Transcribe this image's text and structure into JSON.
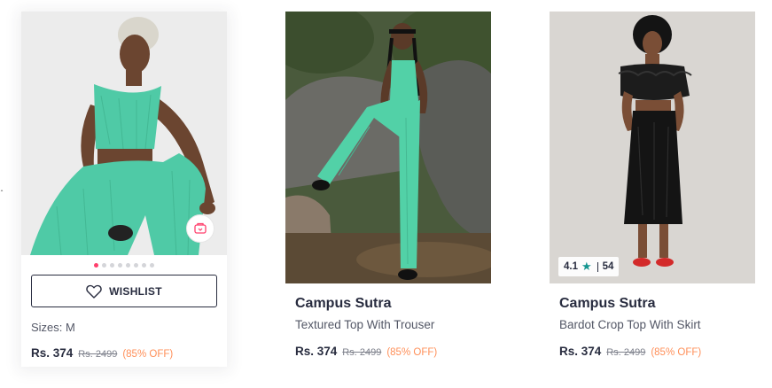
{
  "products": [
    {
      "brand": "",
      "name": "",
      "sizes": "Sizes: M",
      "price": "Rs. 374",
      "mrp": "Rs. 2499",
      "discount": "(85% OFF)",
      "wishlist_label": "WISHLIST",
      "carousel_active_index": 0,
      "carousel_count": 8,
      "colors": {
        "bg": "#ececec",
        "outfit": "#4fcaa6"
      }
    },
    {
      "brand": "Campus Sutra",
      "name": "Textured Top With Trouser",
      "price": "Rs. 374",
      "mrp": "Rs. 2499",
      "discount": "(85% OFF)",
      "colors": {
        "bg": "#4a5a3c",
        "outfit": "#52d1a7"
      }
    },
    {
      "brand": "Campus Sutra",
      "name": "Bardot Crop Top With Skirt",
      "price": "Rs. 374",
      "mrp": "Rs. 2499",
      "discount": "(85% OFF)",
      "rating": "4.1",
      "rating_count": "54",
      "colors": {
        "bg": "#d9d6d2",
        "outfit": "#1a1a1a"
      }
    }
  ],
  "icons": {
    "wishlist": "heart-icon",
    "similar": "similar-products-icon",
    "rating": "star-icon"
  }
}
